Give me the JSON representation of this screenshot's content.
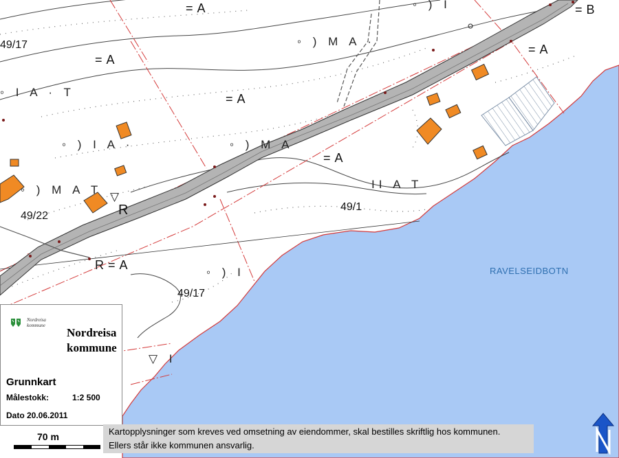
{
  "map": {
    "parcel_labels": [
      "49/17",
      "49/22",
      "49/1",
      "49/17"
    ],
    "landcover_codes": [
      "=A",
      "=A",
      "=A",
      "=A",
      "=A",
      "=B",
      "R=A",
      "R"
    ],
    "place_name": "RAVELSEIDBOTN",
    "colors": {
      "water": "#a9c9f5",
      "building": "#f08a24",
      "road": "#b4b4b4",
      "property_line": "#d43a3a"
    }
  },
  "legend": {
    "logo_text": "Nordreisa kommune",
    "municipality": "Nordreisa kommune",
    "title": "Grunnkart",
    "scale_label": "Målestokk:",
    "scale_value": "1:2 500",
    "date": "Dato 20.06.2011"
  },
  "scalebar": {
    "label": "70 m"
  },
  "disclaimer": {
    "line1": "Kartopplysninger som kreves ved omsetning av eiendommer, skal bestilles skriftlig hos kommunen.",
    "line2": "Ellers står ikke kommunen ansvarlig."
  },
  "north_arrow": {
    "icon": "north-arrow-icon"
  }
}
